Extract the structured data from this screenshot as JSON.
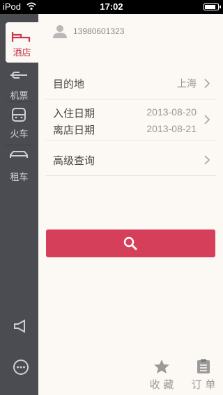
{
  "status_bar": {
    "carrier": "iPod",
    "time": "17:02",
    "battery_level": 0.85
  },
  "sidebar": {
    "items": [
      {
        "label": "酒店",
        "icon": "bed-icon",
        "active": true
      },
      {
        "label": "机票",
        "icon": "airplane-icon",
        "active": false
      },
      {
        "label": "火车",
        "icon": "train-icon",
        "active": false
      },
      {
        "label": "租车",
        "icon": "car-icon",
        "active": false
      }
    ],
    "bottom_icons": [
      "megaphone-icon",
      "more-icon"
    ]
  },
  "user": {
    "phone": "13980601323"
  },
  "form": {
    "destination_label": "目的地",
    "destination_value": "上海",
    "checkin_label": "入住日期",
    "checkin_value": "2013-08-20",
    "checkout_label": "离店日期",
    "checkout_value": "2013-08-21",
    "advanced_label": "高级查询"
  },
  "search_button": {
    "icon": "search-icon"
  },
  "bottom_tabs": [
    {
      "label": "收 藏",
      "icon": "star-icon"
    },
    {
      "label": "订 单",
      "icon": "clipboard-icon"
    }
  ],
  "colors": {
    "accent": "#d63f5a",
    "sidebar_bg": "#4a4c52",
    "panel_bg": "#fcf8f3"
  }
}
